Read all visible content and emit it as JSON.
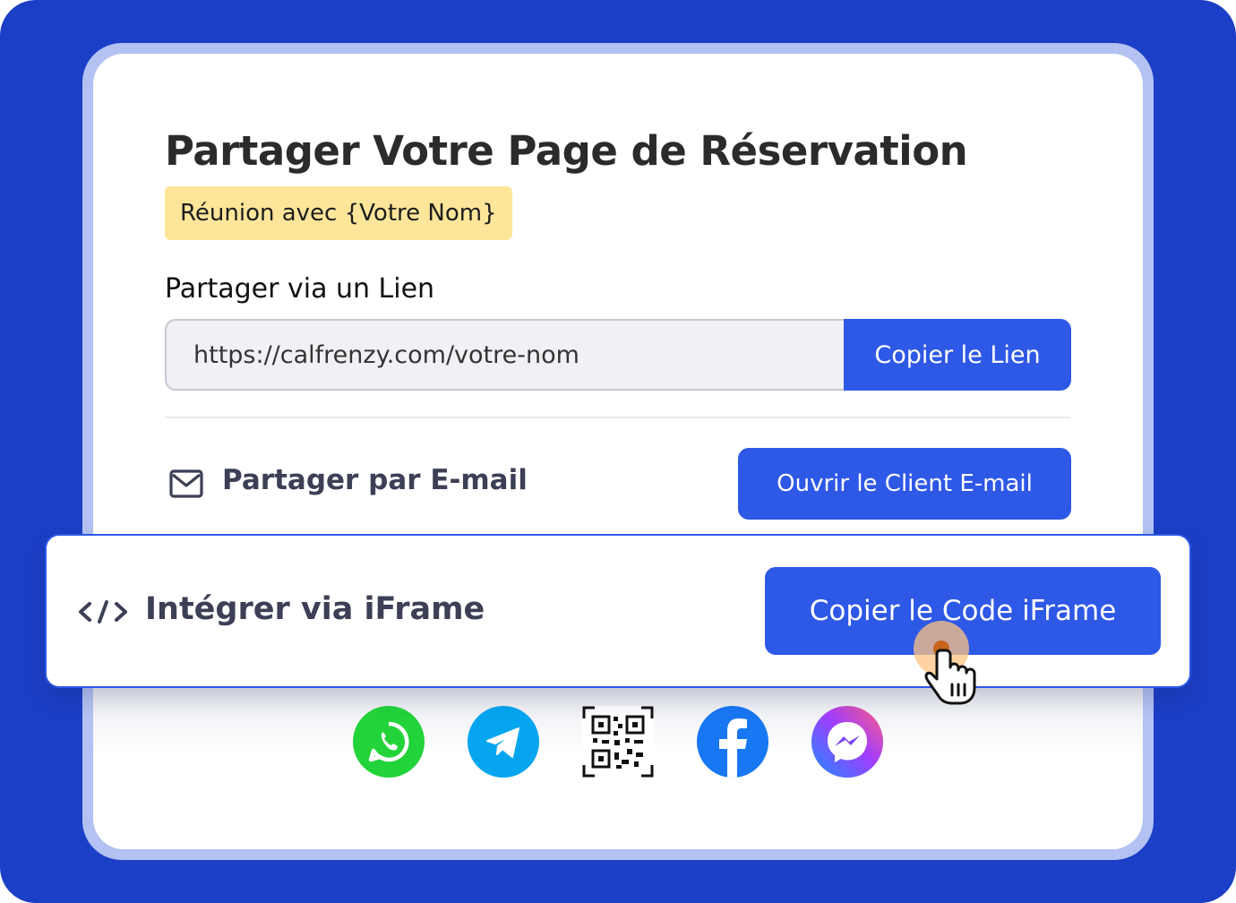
{
  "card": {
    "title": "Partager Votre Page de Réservation",
    "meeting_tag": "Réunion avec {Votre Nom}"
  },
  "link_share": {
    "label": "Partager via un Lien",
    "url_value": "https://calfrenzy.com/votre-nom",
    "copy_button": "Copier le Lien"
  },
  "email_share": {
    "icon": "mail-icon",
    "label": "Partager par E-mail",
    "button": "Ouvrir le Client E-mail"
  },
  "iframe_share": {
    "icon": "code-icon",
    "label": "Intégrer via iFrame",
    "button": "Copier le Code iFrame"
  },
  "social_icons": [
    "whatsapp-icon",
    "telegram-icon",
    "qr-code-icon",
    "facebook-icon",
    "messenger-icon"
  ],
  "colors": {
    "background": "#1c3fc7",
    "accent": "#2e58e6",
    "tag": "#fde69a",
    "whatsapp": "#23d33a",
    "telegram": "#05a5ef",
    "facebook": "#1877f2"
  }
}
